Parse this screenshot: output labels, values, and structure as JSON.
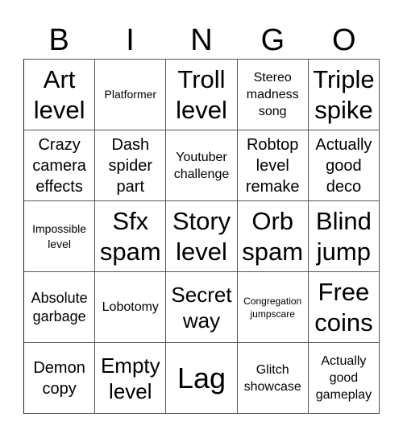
{
  "header": [
    "B",
    "I",
    "N",
    "G",
    "O"
  ],
  "cells": [
    [
      "Art level",
      "Platformer",
      "Troll level",
      "Stereo madness song",
      "Triple spike"
    ],
    [
      "Crazy camera effects",
      "Dash spider part",
      "Youtuber challenge",
      "Robtop level remake",
      "Actually good deco"
    ],
    [
      "Impossible level",
      "Sfx spam",
      "Story level",
      "Orb spam",
      "Blind jump"
    ],
    [
      "Absolute garbage",
      "Lobotomy",
      "Secret way",
      "Congregation jumpscare",
      "Free coins"
    ],
    [
      "Demon copy",
      "Empty level",
      "Lag",
      "Glitch showcase",
      "Actually good gameplay"
    ]
  ]
}
